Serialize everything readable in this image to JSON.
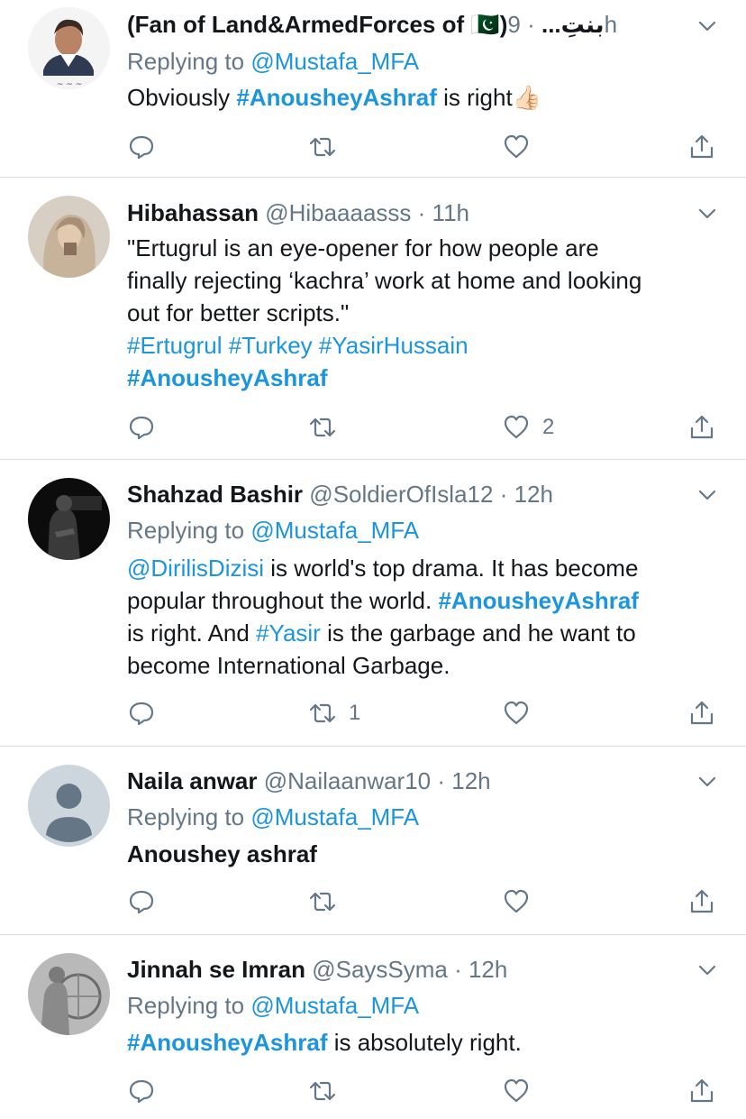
{
  "tweets": [
    {
      "name": "(Fan of Land&ArmedForces of 🇵🇰)بنتِ...",
      "handle": "",
      "time": "· 9h",
      "replying_prefix": "Replying to ",
      "replying_to": "@Mustafa_MFA",
      "body_pre": "Obviously ",
      "body_tag": "#AnousheyAshraf",
      "body_post": " is right👍🏻"
    },
    {
      "name": "Hibahassan",
      "handle": "@Hibaaaasss",
      "time": "· 11h",
      "body_lines": [
        "\"Ertugrul is an eye-opener for how people are",
        "finally rejecting ‘kachra’ work at home and looking",
        "out for better scripts.\""
      ],
      "tags_line": "#Ertugrul #Turkey #YasirHussain",
      "tag_bold": "#AnousheyAshraf",
      "like_count": "2"
    },
    {
      "name": "Shahzad Bashir",
      "handle": "@SoldierOfIsla12",
      "time": "· 12h",
      "replying_prefix": "Replying to ",
      "replying_to": "@Mustafa_MFA",
      "mention": "@DirilisDizisi",
      "l1_post": " is world's top drama. It has become",
      "l2_pre": "popular throughout the world. ",
      "l2_tag": "#AnousheyAshraf",
      "l3_pre": "is right. And ",
      "l3_tag": "#Yasir",
      "l3_post": " is the garbage and he want to",
      "l4": "become International Garbage.",
      "retweet_count": "1"
    },
    {
      "name": "Naila anwar",
      "handle": "@Nailaanwar10",
      "time": "· 12h",
      "replying_prefix": "Replying to ",
      "replying_to": "@Mustafa_MFA",
      "body": "Anoushey ashraf"
    },
    {
      "name": "Jinnah se Imran",
      "handle": "@SaysSyma",
      "time": "· 12h",
      "replying_prefix": "Replying to ",
      "replying_to": "@Mustafa_MFA",
      "body_tag": "#AnousheyAshraf",
      "body_post": " is absolutely right."
    }
  ],
  "icons": {
    "reply": "speech-bubble",
    "retweet": "two-arrows-loop",
    "like": "heart-outline",
    "share": "up-arrow-tray",
    "menu": "chevron-down"
  },
  "colors": {
    "text": "#14171a",
    "secondary": "#657786",
    "link": "#1b95e0",
    "divider": "#d9dee2"
  }
}
